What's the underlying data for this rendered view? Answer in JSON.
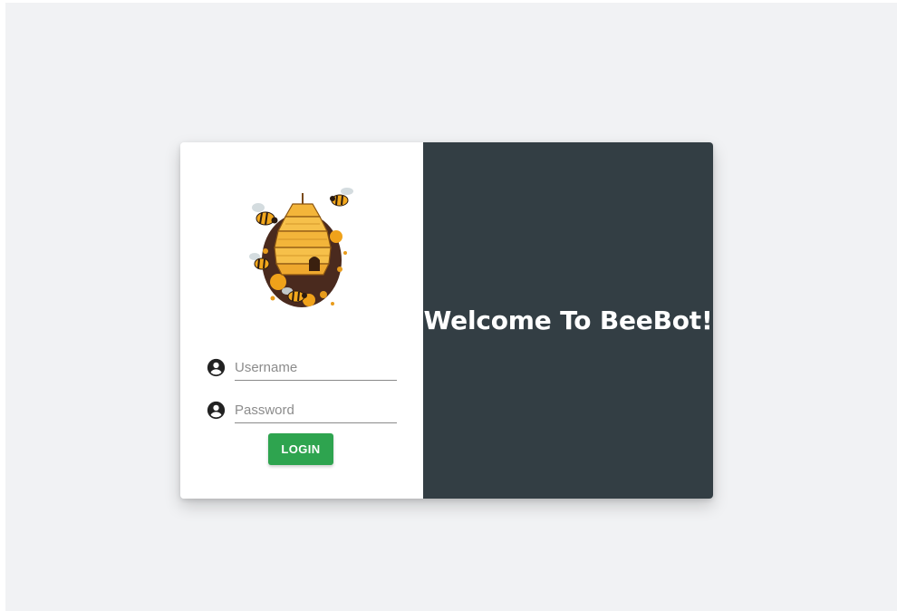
{
  "welcome": {
    "title": "Welcome To BeeBot!"
  },
  "login_form": {
    "username_placeholder": "Username",
    "password_placeholder": "Password",
    "submit_label": "LOGIN"
  },
  "icons": {
    "username_icon": "account-circle-icon",
    "password_icon": "account-circle-icon",
    "logo": "beehive-logo"
  },
  "colors": {
    "page_background": "#f1f2f4",
    "left_panel": "#ffffff",
    "right_panel": "#333e44",
    "login_button": "#2ea44f",
    "welcome_text": "#ffffff"
  }
}
